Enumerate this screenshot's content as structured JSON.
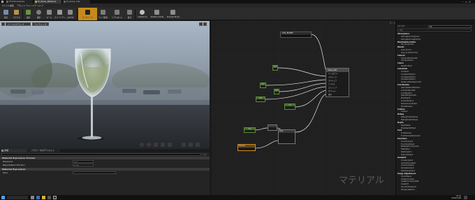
{
  "tabs": [
    {
      "label": "ThirdLineGlass"
    },
    {
      "label": "M_Glass_Material"
    },
    {
      "label": "M_Glass_Inst"
    }
  ],
  "menu": [
    "ファイル",
    "編集",
    "アセット",
    "ウィンドウ",
    "ヘルプ"
  ],
  "toolbar": [
    {
      "label": "保存"
    },
    {
      "label": "ブラウズ"
    },
    {
      "label": "適用"
    },
    {
      "label": "検索"
    },
    {
      "label": "ホーム"
    },
    {
      "label": "クリーンアップ"
    },
    {
      "label": "コネクタ"
    },
    {
      "label": "ライブノード"
    },
    {
      "label": "ライブ更新"
    },
    {
      "label": "リアルタイム"
    },
    {
      "label": "統計"
    },
    {
      "label": "Substance"
    },
    {
      "label": "Platform Stats"
    },
    {
      "label": "Preview Mode"
    }
  ],
  "viewport": {
    "view_mode_label": "パースペクティブ",
    "lit_label": "ライティング"
  },
  "graph": {
    "zoom_label": "ズーム -1",
    "watermark": "マテリアル",
    "main_node": {
      "title": "Glass_Mat",
      "pins": [
        "ベースカラー",
        "メタリック",
        "スペキュラ",
        "ラフネス",
        "エミッシブ",
        "オパシティ",
        "屈折",
        "アンビエントオクルージョン"
      ]
    },
    "param_node_title": "LOG_BLEND",
    "fresnel_node_title": "Fresnel",
    "lerp_node_title": "Lerp",
    "const_labels": [
      "0.1",
      "0.7",
      "0.2",
      "0.4",
      "1.1",
      "0.0"
    ]
  },
  "details": {
    "tabs": [
      "詳細",
      "パラメータのデフォルト"
    ],
    "section1": "Material Expression Fresnel",
    "rows1": [
      {
        "label": "Exponent",
        "value": "3.0"
      },
      {
        "label": "Base Reflect Fraction",
        "value": "0.04"
      }
    ],
    "section2": "Material Expression",
    "rows2": [
      {
        "label": "Desc",
        "value": ""
      }
    ]
  },
  "palette": {
    "filter_label": "カテゴリ",
    "filter_value": "All",
    "search_placeholder": "検索",
    "items": [
      {
        "label": "Atmosphere",
        "cat": true
      },
      {
        "label": "AtmosphericFogColor",
        "cat": false
      },
      {
        "label": "AtmosphericLightColor",
        "cat": false
      },
      {
        "label": "BlendableLocation",
        "cat": true
      },
      {
        "label": "SP_SceneColor",
        "cat": false
      },
      {
        "label": "Blends",
        "cat": true
      },
      {
        "label": "Lerp_3Color",
        "cat": false
      },
      {
        "label": "Lerp_ScratchGrime",
        "cat": false
      },
      {
        "label": "Camera",
        "cat": true
      },
      {
        "label": "CameraPositionWS",
        "cat": false
      },
      {
        "label": "CameraVector",
        "cat": false
      },
      {
        "label": "Colors",
        "cat": true
      },
      {
        "label": "Desaturation",
        "cat": false
      },
      {
        "label": "Constants",
        "cat": true
      },
      {
        "label": "Constant",
        "cat": false
      },
      {
        "label": "Constant2Vector",
        "cat": false
      },
      {
        "label": "Constant3Vector",
        "cat": false
      },
      {
        "label": "Constant4Vector",
        "cat": false
      },
      {
        "label": "DistanceFieldApproxAO",
        "cat": false
      },
      {
        "label": "Coordinates",
        "cat": true
      },
      {
        "label": "AbsoluteWorldPosition",
        "cat": false
      },
      {
        "label": "ActorPositionWS",
        "cat": false
      },
      {
        "label": "LocalPosition",
        "cat": false
      },
      {
        "label": "ObjectPositionWS",
        "cat": false
      },
      {
        "label": "PixelDepth",
        "cat": false
      },
      {
        "label": "ScreenPosition",
        "cat": false
      },
      {
        "label": "TextureCoordinate",
        "cat": false
      },
      {
        "label": "WorldPosition",
        "cat": false
      },
      {
        "label": "Custom",
        "cat": true
      },
      {
        "label": "Custom",
        "cat": false
      },
      {
        "label": "Debug",
        "cat": true
      },
      {
        "label": "DebugFloat2Values",
        "cat": false
      },
      {
        "label": "DebugScalarValues",
        "cat": false
      },
      {
        "label": "Depth",
        "cat": true
      },
      {
        "label": "DepthFade",
        "cat": false
      },
      {
        "label": "PixelDepthOffset",
        "cat": false
      },
      {
        "label": "Font",
        "cat": true
      },
      {
        "label": "FontSample",
        "cat": false
      },
      {
        "label": "FontSampleParameter",
        "cat": false
      },
      {
        "label": "Functions",
        "cat": true
      },
      {
        "label": "FunctionInput",
        "cat": false
      },
      {
        "label": "FunctionOutput",
        "cat": false
      },
      {
        "label": "MaterialFunctionCall",
        "cat": false
      },
      {
        "label": "StaticBool",
        "cat": false
      },
      {
        "label": "StaticSwitch",
        "cat": false
      },
      {
        "label": "TextureObject",
        "cat": false
      },
      {
        "label": "Gradient",
        "cat": true
      },
      {
        "label": "ConeGradient",
        "cat": false
      },
      {
        "label": "CylinderGradient",
        "cat": false
      },
      {
        "label": "LinearGradient",
        "cat": false
      },
      {
        "label": "RadialGradient",
        "cat": false
      },
      {
        "label": "SphereGradient",
        "cat": false
      },
      {
        "label": "Image Adjustment",
        "cat": true
      },
      {
        "label": "3ColorBlend",
        "cat": false
      },
      {
        "label": "CheapContrast",
        "cat": false
      },
      {
        "label": "CheapContrast_RGB",
        "cat": false
      },
      {
        "label": "HueShift",
        "cat": false
      },
      {
        "label": "SmoothThreshold",
        "cat": false
      },
      {
        "label": "SharpenTexture",
        "cat": false
      }
    ]
  },
  "taskbar": {
    "time": "16:32",
    "date": "2016/07/08"
  }
}
